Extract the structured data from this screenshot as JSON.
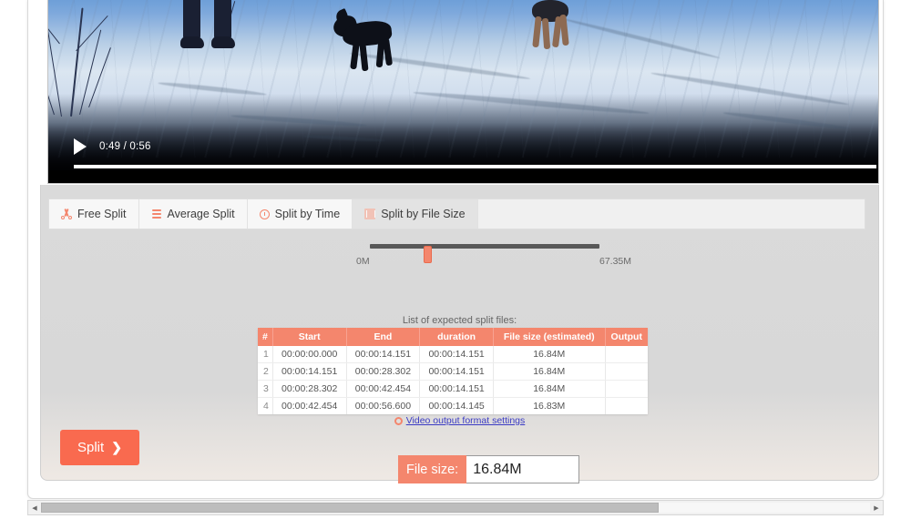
{
  "video": {
    "play_icon": "play-icon",
    "time_display": "0:49 / 0:56",
    "current_time": "0:49",
    "duration": "0:56",
    "progress_percent": 100
  },
  "tabs": [
    {
      "label": "Free Split",
      "icon": "scissors-icon",
      "active": false
    },
    {
      "label": "Average Split",
      "icon": "layers-icon",
      "active": false
    },
    {
      "label": "Split by Time",
      "icon": "clock-icon",
      "active": false
    },
    {
      "label": "Split by File Size",
      "icon": "file-size-icon",
      "active": true
    }
  ],
  "slider": {
    "min_label": "0M",
    "max_label": "67.35M",
    "min_value": 0,
    "max_value": 67.35,
    "value": 16.84,
    "percent": 25
  },
  "filesize": {
    "label": "File size:",
    "value": "16.84M",
    "placeholder": "16.84M"
  },
  "table": {
    "caption": "List of expected split files:",
    "columns": [
      "#",
      "Start",
      "End",
      "duration",
      "File size (estimated)",
      "Output"
    ],
    "rows": [
      {
        "index": "1",
        "start": "00:00:00.000",
        "end": "00:00:14.151",
        "duration": "00:00:14.151",
        "filesize": "16.84M",
        "output": ""
      },
      {
        "index": "2",
        "start": "00:00:14.151",
        "end": "00:00:28.302",
        "duration": "00:00:14.151",
        "filesize": "16.84M",
        "output": ""
      },
      {
        "index": "3",
        "start": "00:00:28.302",
        "end": "00:00:42.454",
        "duration": "00:00:14.151",
        "filesize": "16.84M",
        "output": ""
      },
      {
        "index": "4",
        "start": "00:00:42.454",
        "end": "00:00:56.600",
        "duration": "00:00:14.145",
        "filesize": "16.83M",
        "output": ""
      }
    ]
  },
  "settings": {
    "link_label": "Video output format settings",
    "icon": "gear-icon"
  },
  "actions": {
    "split_label": "Split",
    "split_chevron": "❯"
  },
  "scrollbar": {
    "left_arrow": "◀",
    "right_arrow": "▶",
    "thumb_percent": 74.5
  },
  "colors": {
    "accent": "#f4866d",
    "button": "#f96a4f",
    "link": "#3b3bc4",
    "panel_bg": "#dadada"
  }
}
